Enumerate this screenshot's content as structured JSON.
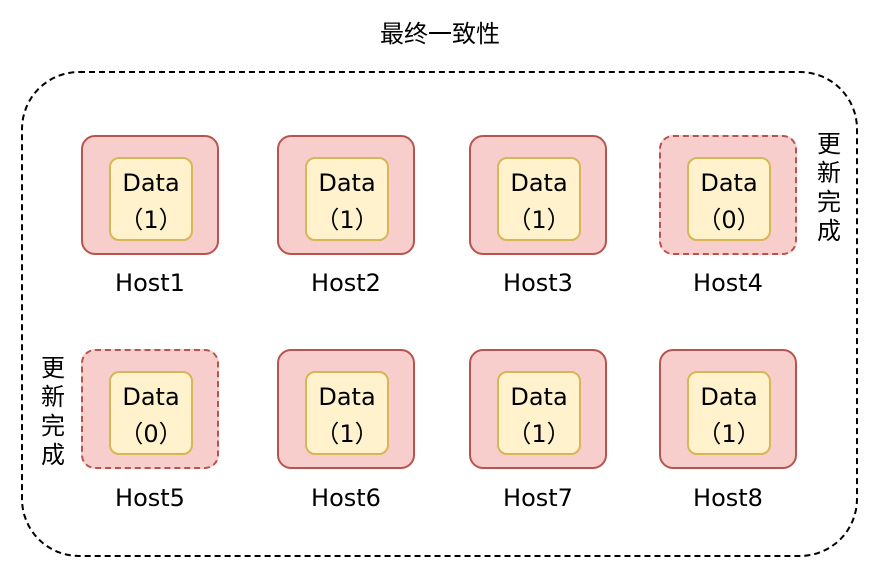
{
  "title": "最终一致性",
  "hosts": [
    {
      "name": "Host1",
      "data_label": "Data",
      "value": "（1）",
      "updated": false
    },
    {
      "name": "Host2",
      "data_label": "Data",
      "value": "（1）",
      "updated": false
    },
    {
      "name": "Host3",
      "data_label": "Data",
      "value": "（1）",
      "updated": false
    },
    {
      "name": "Host4",
      "data_label": "Data",
      "value": "（0）",
      "updated": true
    },
    {
      "name": "Host5",
      "data_label": "Data",
      "value": "（0）",
      "updated": true
    },
    {
      "name": "Host6",
      "data_label": "Data",
      "value": "（1）",
      "updated": false
    },
    {
      "name": "Host7",
      "data_label": "Data",
      "value": "（1）",
      "updated": false
    },
    {
      "name": "Host8",
      "data_label": "Data",
      "value": "（1）",
      "updated": false
    }
  ],
  "notes": {
    "host4_note": "更\n新\n完\n成",
    "host5_note": "更\n新\n完\n成"
  },
  "colors": {
    "host_fill": "#f8cecc",
    "host_border": "#b85450",
    "data_fill": "#fff2cc",
    "data_border": "#d6b656"
  }
}
